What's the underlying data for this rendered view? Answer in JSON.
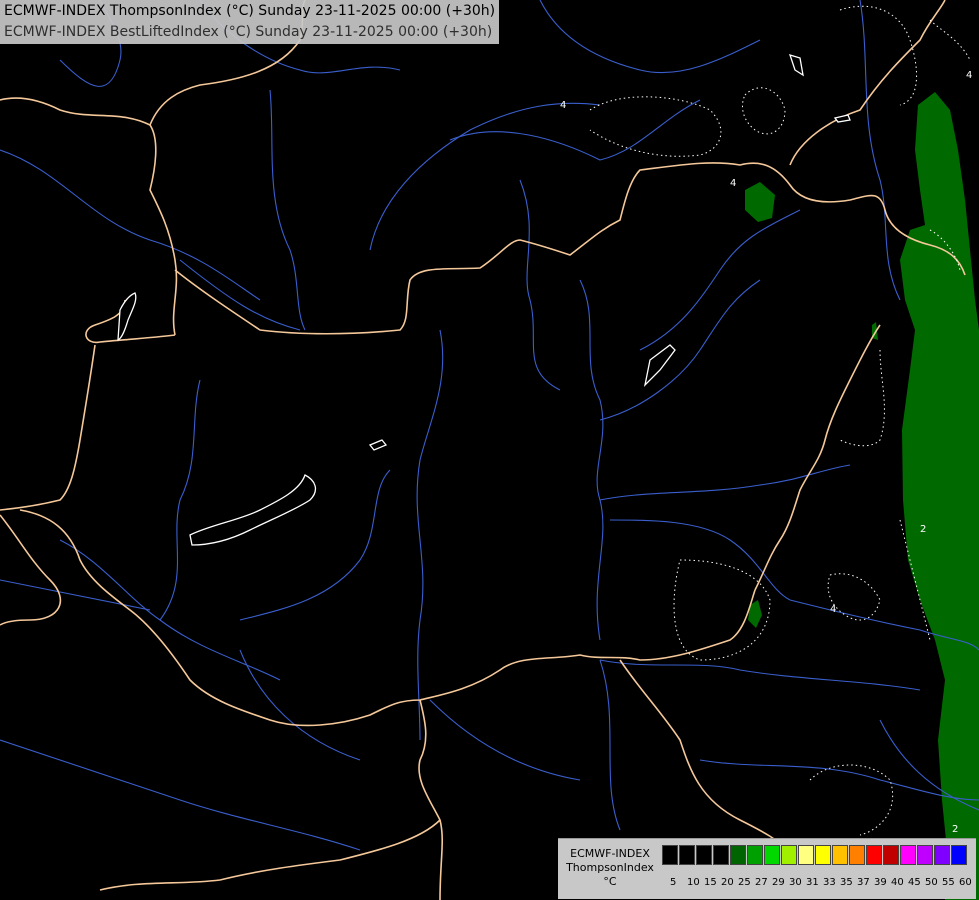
{
  "title": {
    "line1": "ECMWF-INDEX ThompsonIndex (°C) Sunday 23-11-2025 00:00 (+30h)",
    "line2": "ECMWF-INDEX BestLiftedIndex (°C) Sunday 23-11-2025 00:00 (+30h)"
  },
  "legend": {
    "line1": "ECMWF-INDEX",
    "line2": "ThompsonIndex",
    "line3": "°C",
    "colors": [
      "#000000",
      "#000000",
      "#000000",
      "#000000",
      "#006400",
      "#00a000",
      "#00d800",
      "#a0f000",
      "#ffff80",
      "#ffff00",
      "#ffc000",
      "#ff8000",
      "#ff0000",
      "#c00000",
      "#ff00ff",
      "#c000ff",
      "#8000ff",
      "#0000ff"
    ],
    "ticks": [
      "5",
      "10",
      "15",
      "20",
      "25",
      "27",
      "29",
      "30",
      "31",
      "33",
      "35",
      "37",
      "39",
      "40",
      "45",
      "50",
      "55",
      "60"
    ]
  },
  "contour_labels": [
    "4",
    "4",
    "4",
    "4",
    "2",
    "2"
  ],
  "colors": {
    "background": "#000000",
    "borders": "#f5c89a",
    "rivers": "#3a5fcd",
    "lakes": "#ffffff",
    "field_green": "#006400",
    "contour": "#ffffff"
  }
}
